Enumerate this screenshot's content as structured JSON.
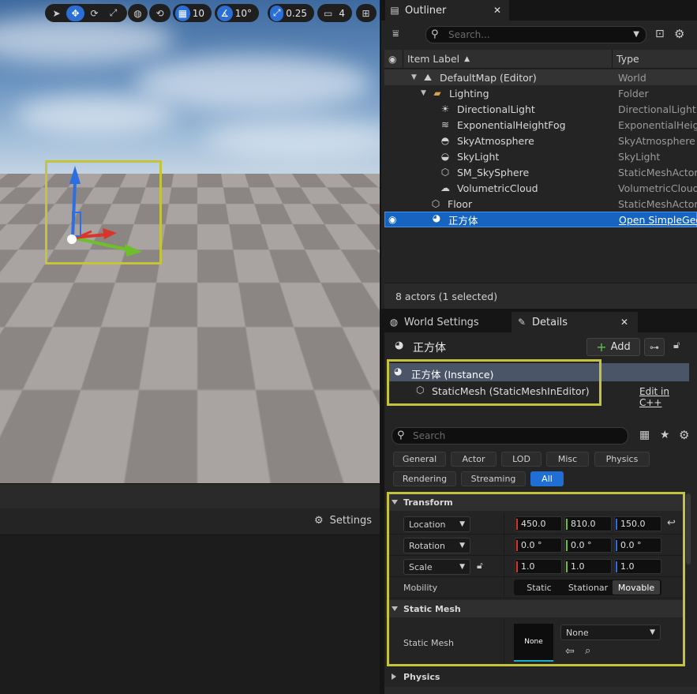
{
  "toolbar": {
    "grid_snap": "10",
    "rotation_snap": "10°",
    "scale_snap": "0.25",
    "camera_speed": "4"
  },
  "viewport_bar": {
    "settings_label": "Settings"
  },
  "outliner": {
    "tab_title": "Outliner",
    "search_placeholder": "Search...",
    "col_label": "Item Label",
    "col_type": "Type",
    "rows": [
      {
        "label": "DefaultMap (Editor)",
        "type": "World"
      },
      {
        "label": "Lighting",
        "type": "Folder"
      },
      {
        "label": "DirectionalLight",
        "type": "DirectionalLight"
      },
      {
        "label": "ExponentialHeightFog",
        "type": "ExponentialHeightFog"
      },
      {
        "label": "SkyAtmosphere",
        "type": "SkyAtmosphere"
      },
      {
        "label": "SkyLight",
        "type": "SkyLight"
      },
      {
        "label": "SM_SkySphere",
        "type": "StaticMeshActor"
      },
      {
        "label": "VolumetricCloud",
        "type": "VolumetricCloud"
      },
      {
        "label": "Floor",
        "type": "StaticMeshActor"
      },
      {
        "label": "正方体",
        "type": "Open SimpleGeo"
      }
    ],
    "status": "8 actors (1 selected)"
  },
  "details": {
    "tab_world_settings": "World Settings",
    "tab_details": "Details",
    "actor_name": "正方体",
    "add_label": "Add",
    "instance_label": "正方体 (Instance)",
    "component_label": "StaticMesh (StaticMeshInEditor)",
    "edit_cpp": "Edit in C++",
    "search_placeholder": "Search",
    "filters": [
      "General",
      "Actor",
      "LOD",
      "Misc",
      "Physics",
      "Rendering",
      "Streaming",
      "All"
    ],
    "transform": {
      "section": "Transform",
      "location_label": "Location",
      "rotation_label": "Rotation",
      "scale_label": "Scale",
      "location": [
        "450.0",
        "810.0",
        "150.0"
      ],
      "rotation": [
        "0.0 °",
        "0.0 °",
        "0.0 °"
      ],
      "scale": [
        "1.0",
        "1.0",
        "1.0"
      ],
      "mobility_label": "Mobility",
      "mobility_static": "Static",
      "mobility_stationary": "Stationar",
      "mobility_movable": "Movable"
    },
    "static_mesh": {
      "section": "Static Mesh",
      "label": "Static Mesh",
      "thumb": "None",
      "value": "None"
    },
    "physics_section": "Physics"
  },
  "colors": {
    "accent": "#1f6fd6",
    "highlight": "#c4c33a",
    "x_axis": "#d9352b",
    "y_axis": "#6fbf2b",
    "z_axis": "#2d6fe0"
  }
}
